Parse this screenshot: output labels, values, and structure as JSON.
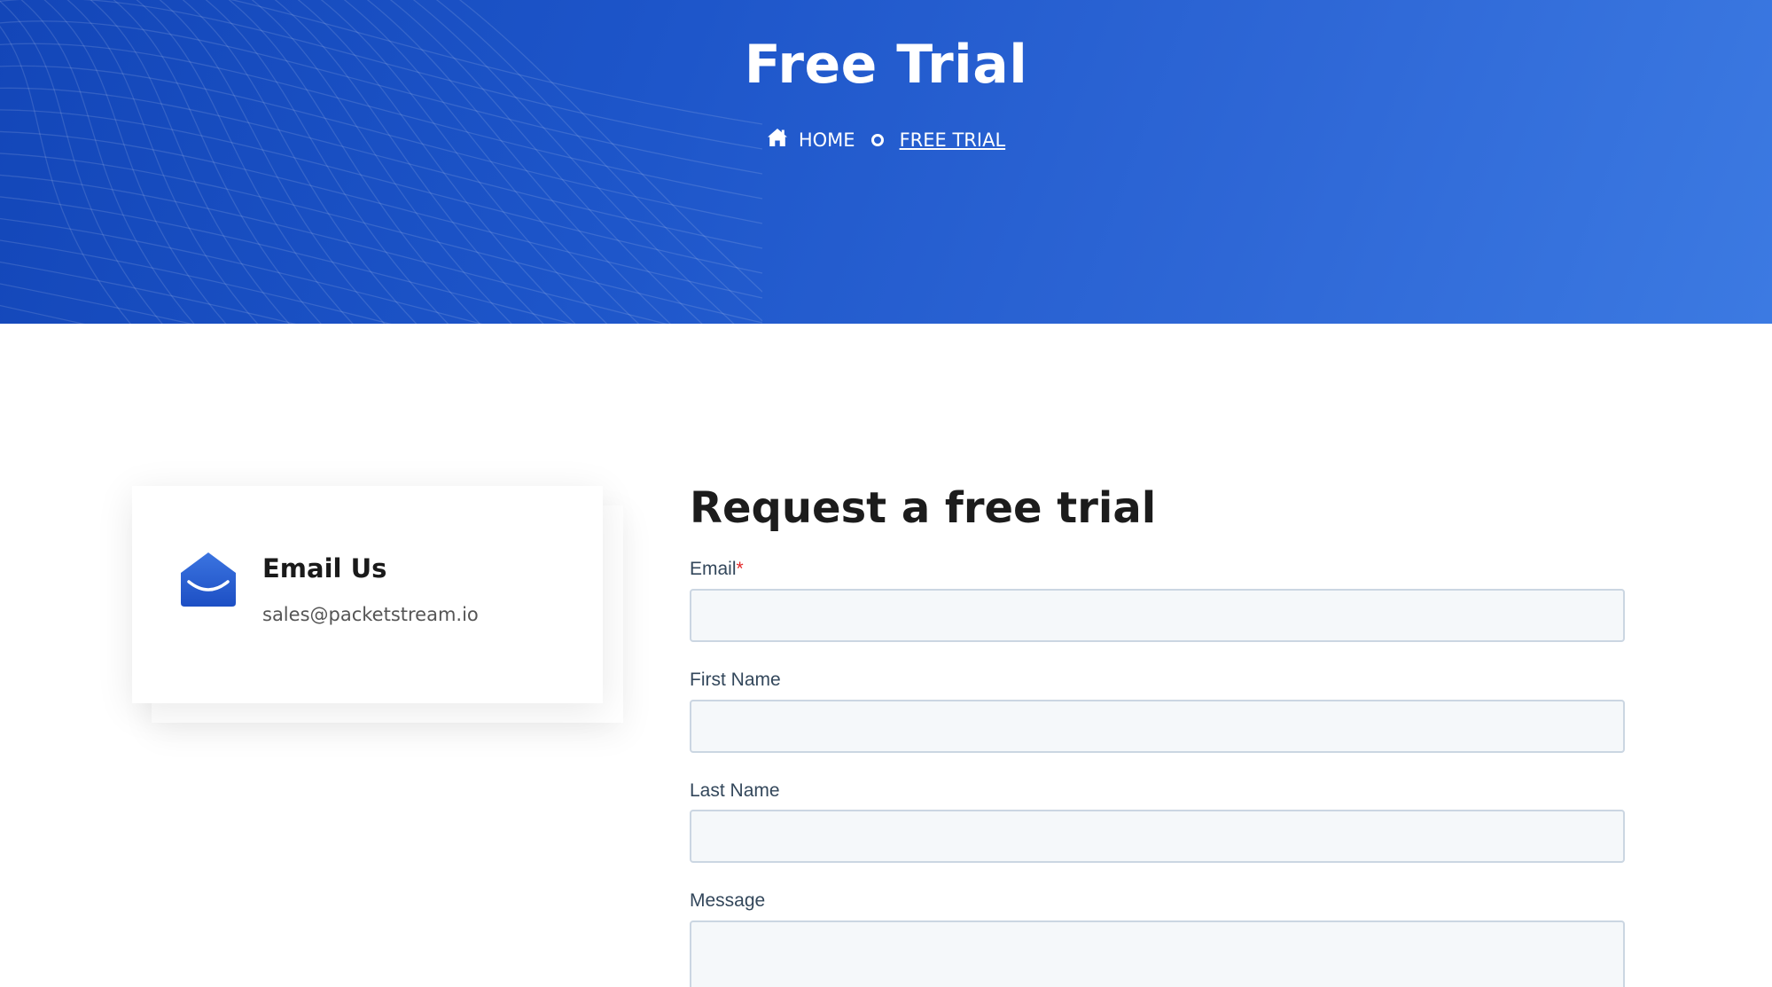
{
  "hero": {
    "title": "Free Trial",
    "breadcrumb": {
      "home_label": "HOME",
      "current_label": "FREE TRIAL",
      "home_icon": "home-icon",
      "separator_icon": "circle-separator-icon"
    }
  },
  "contact_card": {
    "icon": "open-envelope-icon",
    "title": "Email Us",
    "email": "sales@packetstream.io"
  },
  "form": {
    "heading": "Request a free trial",
    "fields": {
      "email": {
        "label": "Email",
        "required_mark": "*",
        "value": ""
      },
      "first_name": {
        "label": "First Name",
        "value": ""
      },
      "last_name": {
        "label": "Last Name",
        "value": ""
      },
      "message": {
        "label": "Message",
        "value": ""
      }
    }
  },
  "colors": {
    "hero_start": "#1346b8",
    "hero_end": "#3c7ae2",
    "accent": "#2a5fd4",
    "required": "#e3292a",
    "input_bg": "#f5f8fa",
    "input_border": "#cbd6e2",
    "label": "#33475b"
  }
}
